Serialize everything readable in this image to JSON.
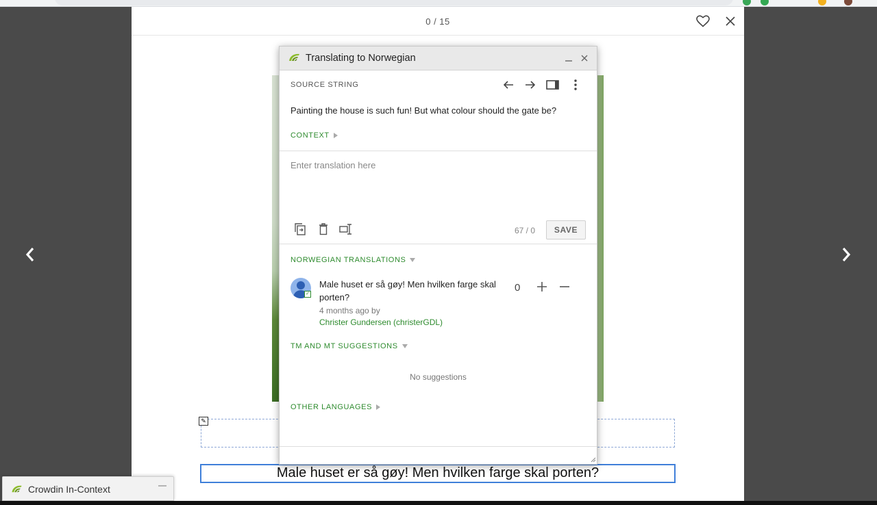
{
  "reader": {
    "page_counter": "0 / 15"
  },
  "dialog": {
    "title": "Translating to Norwegian",
    "source_label": "SOURCE STRING",
    "source_text": "Painting the house is such fun! But what colour should the gate be?",
    "context_label": "CONTEXT",
    "translation_placeholder": "Enter translation here",
    "char_count": "67 / 0",
    "save_label": "SAVE",
    "translations_label": "NORWEGIAN TRANSLATIONS",
    "translation": {
      "text": "Male huset er så gøy! Men hvilken farge skal porten?",
      "meta": "4 months ago by",
      "author": "Christer Gundersen (christerGDL)",
      "votes": "0"
    },
    "suggestions_label": "TM AND MT SUGGESTIONS",
    "no_suggestions": "No suggestions",
    "other_languages_label": "OTHER LANGUAGES"
  },
  "page_text": {
    "translated_caption": "Male huset er så gøy! Men hvilken farge skal porten?"
  },
  "incontext": {
    "label": "Crowdin In-Context"
  },
  "colors": {
    "accent_green": "#2e8b2e",
    "focus_blue": "#3f7fd9",
    "backdrop": "#4a4a4a"
  },
  "icons": {
    "favorite": "heart-icon",
    "close": "close-icon",
    "prev_page": "chevron-left-icon",
    "next_page": "chevron-right-icon",
    "prev_string": "arrow-left-icon",
    "next_string": "arrow-right-icon",
    "layout": "panel-layout-icon",
    "more": "more-vertical-icon",
    "copy_source": "copy-source-icon",
    "clear": "trash-icon",
    "transliterate": "text-cursor-icon",
    "vote_up": "plus-icon",
    "vote_down": "minus-icon"
  }
}
